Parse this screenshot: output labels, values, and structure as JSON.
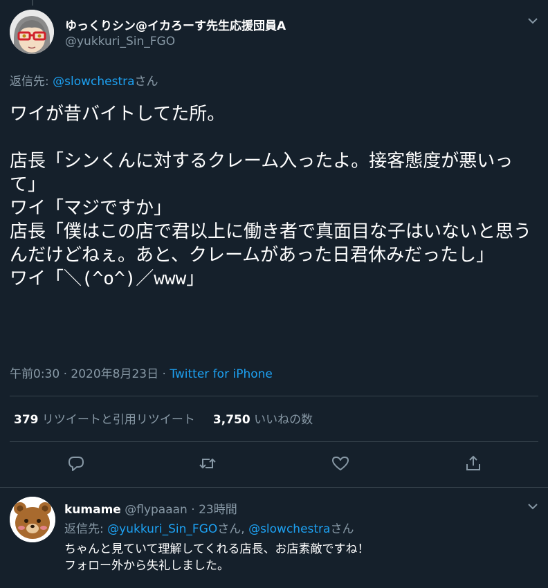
{
  "tweet": {
    "display_name": "ゆっくりシン@イカろーす先生応援団員A",
    "handle": "@yukkuri_Sin_FGO",
    "reply_prefix": "返信先: ",
    "reply_to": "@slowchestra",
    "reply_suffix": "さん",
    "text": "ワイが昔バイトしてた所。\n\n店長「シンくんに対するクレーム入ったよ。接客態度が悪いって」\nワイ「マジですか」\n店長「僕はこの店で君以上に働き者で真面目な子はいないと思うんだけどねぇ。あと、クレームがあった日君休みだったし」\nワイ「＼(^o^)／www」",
    "time": "午前0:30 · 2020年8月23日 · ",
    "source": "Twitter for iPhone",
    "retweets_count": "379",
    "retweets_label": " リツイートと引用リツイート",
    "likes_count": "3,750",
    "likes_label": " いいねの数"
  },
  "actions": {
    "reply_icon": "comment-icon",
    "retweet_icon": "retweet-icon",
    "like_icon": "heart-icon",
    "share_icon": "share-icon"
  },
  "reply": {
    "display_name": "kumame",
    "handle": "@flypaaan",
    "dot": " · ",
    "time": "23時間",
    "reply_prefix": "返信先: ",
    "reply_to_1": "@yukkuri_Sin_FGO",
    "reply_mid": "さん, ",
    "reply_to_2": "@slowchestra",
    "reply_suffix": "さん",
    "text": "ちゃんと見ていて理解してくれる店長、お店素敵ですね！\nフォロー外から失礼しました。"
  },
  "colors": {
    "background": "#15202b",
    "accent": "#1da1f2",
    "secondary_text": "#8899a6",
    "divider": "#38444d"
  }
}
